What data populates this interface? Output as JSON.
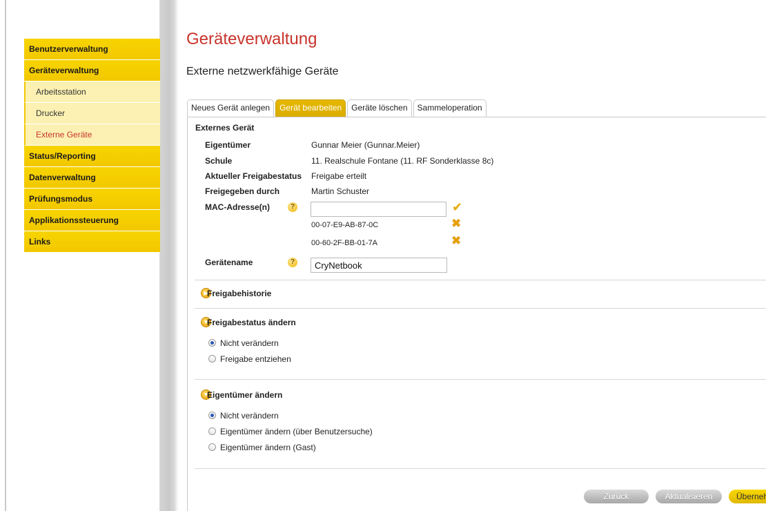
{
  "sidebar": {
    "items": [
      {
        "label": "Benutzerverwaltung"
      },
      {
        "label": "Geräteverwaltung"
      },
      {
        "label": "Arbeitsstation"
      },
      {
        "label": "Drucker"
      },
      {
        "label": "Externe Geräte"
      },
      {
        "label": "Status/Reporting"
      },
      {
        "label": "Datenverwaltung"
      },
      {
        "label": "Prüfungsmodus"
      },
      {
        "label": "Applikationssteuerung"
      },
      {
        "label": "Links"
      }
    ]
  },
  "main": {
    "title": "Geräteverwaltung",
    "subtitle": "Externe netzwerkfähige Geräte",
    "tabs": [
      {
        "label": "Neues Gerät anlegen"
      },
      {
        "label": "Gerät bearbeiten"
      },
      {
        "label": "Geräte löschen"
      },
      {
        "label": "Sammeloperation"
      }
    ],
    "device": {
      "section_title": "Externes Gerät",
      "owner_label": "Eigentümer",
      "owner_value": "Gunnar Meier (Gunnar.Meier)",
      "school_label": "Schule",
      "school_value": "11. Realschule Fontane (11. RF Sonderklasse 8c)",
      "status_label": "Aktueller Freigabestatus",
      "status_value": "Freigabe erteilt",
      "approved_by_label": "Freigegeben durch",
      "approved_by_value": "Martin Schuster",
      "mac_label": "MAC-Adresse(n)",
      "mac_input_value": "",
      "mac_addresses": [
        "00-07-E9-AB-87-0C",
        "00-60-2F-BB-01-7A"
      ],
      "name_label": "Gerätename",
      "name_value": "CryNetbook",
      "help_glyph": "?",
      "check_glyph": "✔",
      "remove_glyph": "✖"
    },
    "history": {
      "title": "Freigabehistorie"
    },
    "change_status": {
      "title": "Freigabestatus ändern",
      "options": [
        "Nicht verändern",
        "Freigabe entziehen"
      ],
      "selected": 0
    },
    "change_owner": {
      "title": "Eigentümer ändern",
      "options": [
        "Nicht verändern",
        "Eigentümer ändern (über Benutzersuche)",
        "Eigentümer ändern (Gast)"
      ],
      "selected": 0
    },
    "buttons": {
      "back": "Zurück",
      "refresh": "Aktualisieren",
      "apply": "Übernehmen"
    }
  },
  "colors": {
    "accent_yellow": "#f2c800",
    "title_red": "#c8342c",
    "submenu_bg": "#fcf1b2"
  }
}
